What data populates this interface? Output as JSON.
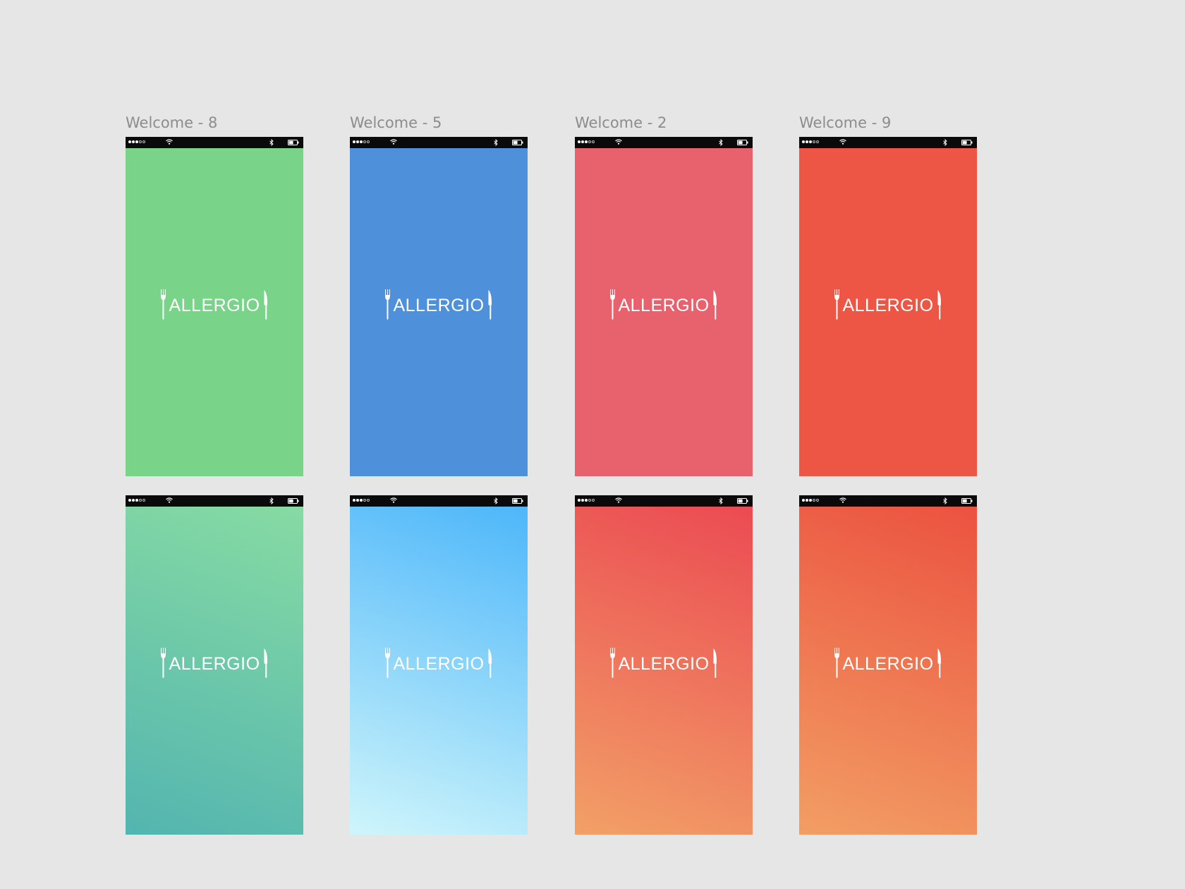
{
  "canvas": {
    "background": "#e6e6e6"
  },
  "app_name": "ALLERGIO",
  "artboards": [
    {
      "title": "Welcome - 8",
      "background": "#79d389",
      "gradient": null
    },
    {
      "title": "Welcome - 5",
      "background": "#4f90da",
      "gradient": null
    },
    {
      "title": "Welcome - 2",
      "background": "#e8626d",
      "gradient": null
    },
    {
      "title": "Welcome - 9",
      "background": "#ed5645",
      "gradient": null
    },
    {
      "title": "",
      "background": "#6ec8a6",
      "gradient": {
        "angle": "200deg",
        "from": "#88dca2",
        "to": "#53b5b0"
      }
    },
    {
      "title": "",
      "background": "#7fd1f8",
      "gradient": {
        "angle": "200deg",
        "from": "#4ab5f9",
        "to": "#cff5fb"
      }
    },
    {
      "title": "",
      "background": "#ec6c5c",
      "gradient": {
        "angle": "200deg",
        "from": "#eb4852",
        "to": "#f2a067"
      }
    },
    {
      "title": "",
      "background": "#ee7050",
      "gradient": {
        "angle": "200deg",
        "from": "#eb503f",
        "to": "#f29e64"
      }
    }
  ],
  "status_bar": {
    "icons": [
      "signal-dots-icon",
      "wifi-icon",
      "bluetooth-icon",
      "battery-icon"
    ]
  }
}
